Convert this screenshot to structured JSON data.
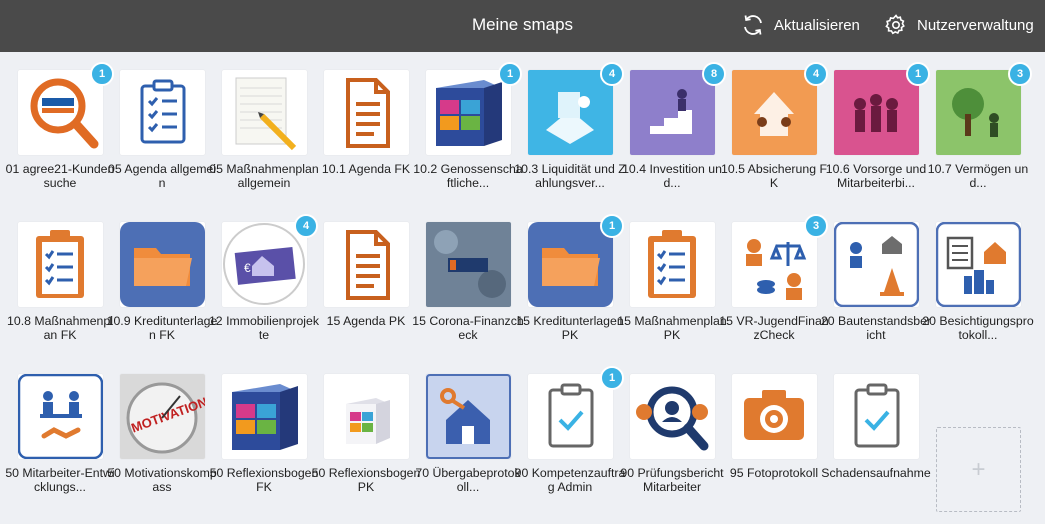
{
  "header": {
    "title": "Meine smaps",
    "refresh_label": "Aktualisieren",
    "users_label": "Nutzerverwaltung"
  },
  "colors": {
    "header_bg": "#4a4a4a",
    "badge": "#3ab2e4",
    "accent_orange": "#e07a2f",
    "accent_blue": "#4d6fb5"
  },
  "tiles": [
    {
      "label": "01 agree21-Kundensuche",
      "badge": "1",
      "icon": "magnifier-bank-logo"
    },
    {
      "label": "05 Agenda allgemein",
      "badge": "",
      "icon": "clipboard-checklist-blue"
    },
    {
      "label": "05 Maßnahmenplan allgemein",
      "badge": "",
      "icon": "notepad-pencil"
    },
    {
      "label": "10.1 Agenda FK",
      "badge": "",
      "icon": "document-orange"
    },
    {
      "label": "10.2 Genossenschaftliche...",
      "badge": "1",
      "icon": "product-box"
    },
    {
      "label": "10.3 Liquidität und Zahlungsver...",
      "badge": "4",
      "icon": "liquidity-illustration"
    },
    {
      "label": "10.4 Investition und...",
      "badge": "8",
      "icon": "investment-illustration"
    },
    {
      "label": "10.5 Absicherung FK",
      "badge": "4",
      "icon": "protection-illustration"
    },
    {
      "label": "10.6 Vorsorge und Mitarbeiterbi...",
      "badge": "1",
      "icon": "provision-illustration"
    },
    {
      "label": "10.7 Vermögen und...",
      "badge": "3",
      "icon": "wealth-tree-illustration"
    },
    {
      "label": "10.8 Maßnahmenplan FK",
      "badge": "",
      "icon": "clipboard-checklist-orange"
    },
    {
      "label": "10.9 Kreditunterlagen FK",
      "badge": "",
      "icon": "folder-blue"
    },
    {
      "label": "12 Immobilienprojekte",
      "badge": "4",
      "icon": "real-estate-banknote"
    },
    {
      "label": "15 Agenda PK",
      "badge": "",
      "icon": "document-orange"
    },
    {
      "label": "15 Corona-Finanzcheck",
      "badge": "",
      "icon": "corona-photo"
    },
    {
      "label": "15 Kreditunterlagen PK",
      "badge": "1",
      "icon": "folder-blue"
    },
    {
      "label": "15 Maßnahmenplan PK",
      "badge": "",
      "icon": "clipboard-checklist-orange"
    },
    {
      "label": "15 VR-JugendFinanzCheck",
      "badge": "3",
      "icon": "youth-finance"
    },
    {
      "label": "20 Bautenstandsbericht",
      "badge": "",
      "icon": "construction-report"
    },
    {
      "label": "20 Besichtigungsprotokoll...",
      "badge": "",
      "icon": "inspection-protocol"
    },
    {
      "label": "50 Mitarbeiter-Entwicklungs...",
      "badge": "",
      "icon": "employee-meeting"
    },
    {
      "label": "50 Motivationskompass",
      "badge": "",
      "icon": "motivation-compass"
    },
    {
      "label": "50 Reflexionsbogen FK",
      "badge": "",
      "icon": "product-box"
    },
    {
      "label": "50 Reflexionsbogen PK",
      "badge": "",
      "icon": "product-box-small"
    },
    {
      "label": "70 Übergabeprotokoll...",
      "badge": "",
      "icon": "house-key"
    },
    {
      "label": "90 Kompetenzauftrag Admin",
      "badge": "1",
      "icon": "clipboard-check"
    },
    {
      "label": "90 Prüfungsbericht Mitarbeiter",
      "badge": "",
      "icon": "audit-magnifier"
    },
    {
      "label": "95 Fotoprotokoll",
      "badge": "",
      "icon": "camera"
    },
    {
      "label": "Schadensaufnahme",
      "badge": "",
      "icon": "clipboard-check"
    }
  ],
  "add_tile": {
    "icon": "plus-icon",
    "glyph": "+"
  }
}
